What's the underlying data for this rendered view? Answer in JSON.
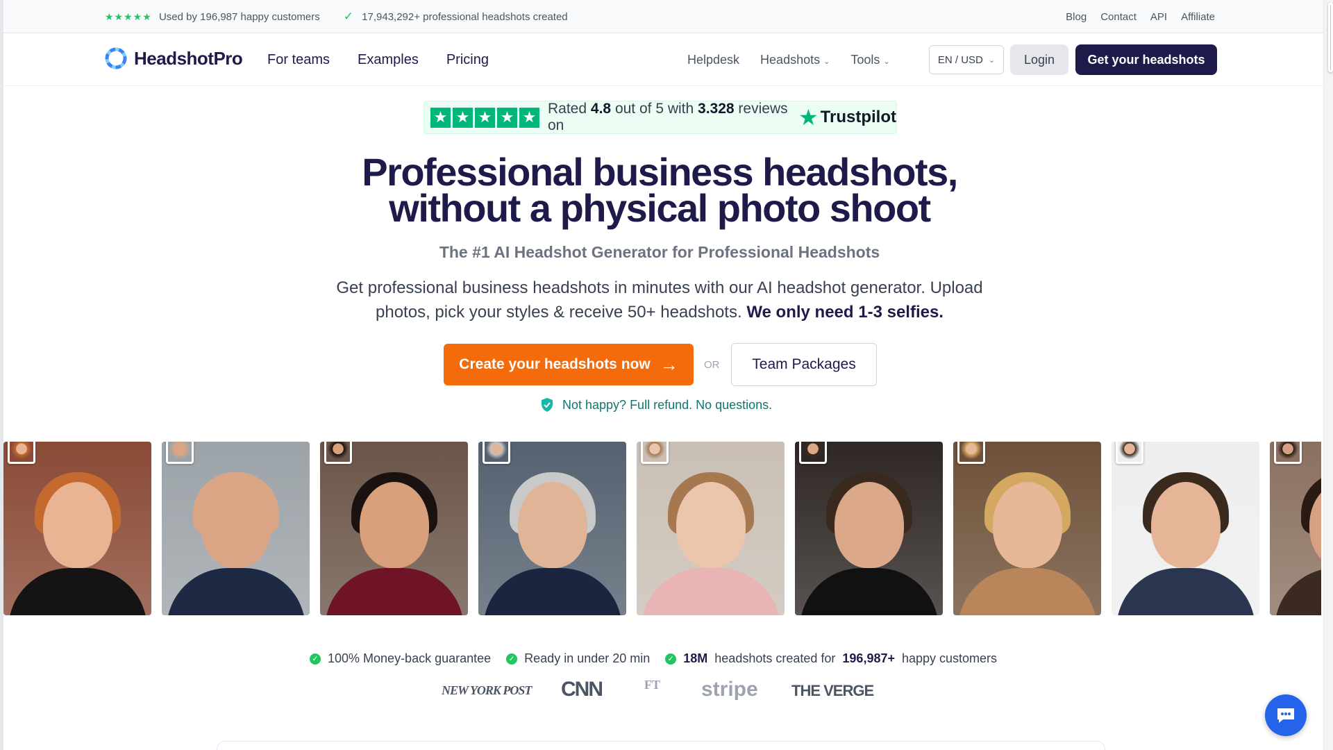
{
  "topbar": {
    "stars": "★★★★★",
    "customers_text": "Used by 196,987 happy customers",
    "headshots_text": "17,943,292+ professional headshots created",
    "links": [
      "Blog",
      "Contact",
      "API",
      "Affiliate"
    ]
  },
  "nav": {
    "logo": "HeadshotPro",
    "main": [
      "For teams",
      "Examples",
      "Pricing"
    ],
    "helpdesk": "Helpdesk",
    "headshots": "Headshots",
    "tools": "Tools",
    "lang": "EN / USD",
    "login": "Login",
    "cta": "Get your headshots"
  },
  "trustpilot": {
    "rated": "Rated",
    "score": "4.8",
    "out_of": "out of 5 with",
    "reviews": "3.328",
    "reviews_on": "reviews on",
    "brand": "Trustpilot"
  },
  "hero": {
    "title_line1": "Professional business headshots,",
    "title_line2": "without a physical photo shoot",
    "subtitle": "The #1 AI Headshot Generator for Professional Headshots",
    "desc_plain": "Get professional business headshots in minutes with our AI headshot generator. Upload photos, pick your styles & receive 50+ headshots.",
    "desc_bold": "We only need 1-3 selfies.",
    "cta": "Create your headshots now",
    "or": "OR",
    "team": "Team Packages",
    "refund": "Not happy? Full refund. No questions."
  },
  "photos": [
    {
      "bg": "#8a4a36",
      "skin": "#e8b494",
      "hair": "#c46a2e",
      "body": "#141414"
    },
    {
      "bg": "#9ca3a8",
      "skin": "#d9a584",
      "hair": "#d9a584",
      "body": "#1e2a44"
    },
    {
      "bg": "#6b5548",
      "skin": "#d9a07c",
      "hair": "#1a1210",
      "body": "#6e1426"
    },
    {
      "bg": "#556170",
      "skin": "#e0b497",
      "hair": "#c9c9c9",
      "body": "#1c2540"
    },
    {
      "bg": "#c9bfb5",
      "skin": "#ecc6ac",
      "hair": "#a67850",
      "body": "#e8b4b4"
    },
    {
      "bg": "#2e2724",
      "skin": "#dca88a",
      "hair": "#3a2a1e",
      "body": "#111111"
    },
    {
      "bg": "#6e5038",
      "skin": "#e6b898",
      "hair": "#d4a860",
      "body": "#b8865a"
    },
    {
      "bg": "#eeeeee",
      "skin": "#e6b496",
      "hair": "#3a2a1e",
      "body": "#2a3550"
    },
    {
      "bg": "#8a7060",
      "skin": "#d6a084",
      "hair": "#2a1a12",
      "body": "#3a2a22"
    }
  ],
  "features": {
    "f1": "100% Money-back guarantee",
    "f2": "Ready in under 20 min",
    "f3_num": "18M",
    "f3_mid": "headshots created for",
    "f3_num2": "196,987+",
    "f3_end": "happy customers"
  },
  "press": {
    "nypost": "NEW YORK POST",
    "cnn": "CNN",
    "ft": "FT",
    "stripe": "stripe",
    "verge": "THE VERGE"
  },
  "colors": {
    "brand": "#1e1b4b",
    "accent": "#f36b0a",
    "trustpilot": "#00b67a",
    "check": "#22c55e"
  }
}
